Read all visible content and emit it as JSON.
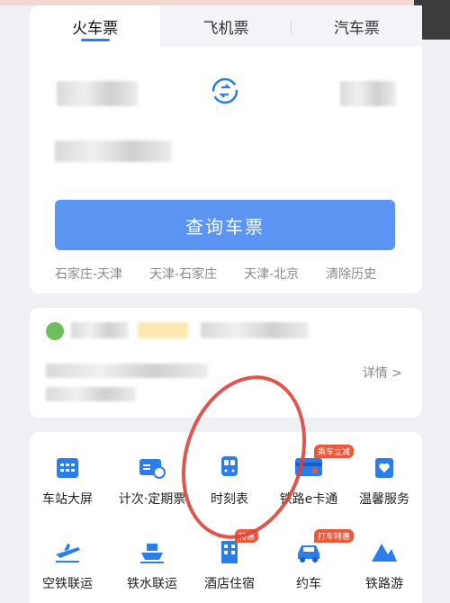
{
  "tabs": [
    {
      "label": "火车票",
      "active": true
    },
    {
      "label": "飞机票",
      "active": false
    },
    {
      "label": "汽车票",
      "active": false
    }
  ],
  "search_button": "查询车票",
  "history": [
    "石家庄-天津",
    "天津-石家庄",
    "天津-北京"
  ],
  "clear_history": "清除历史",
  "order_detail": "详情 >",
  "services": [
    {
      "label": "车站大屏",
      "icon": "station-screen-icon",
      "tag": ""
    },
    {
      "label": "计次·定期票",
      "icon": "ticket-clock-icon",
      "tag": ""
    },
    {
      "label": "时刻表",
      "icon": "train-icon",
      "tag": ""
    },
    {
      "label": "铁路e卡通",
      "icon": "card-icon",
      "tag": "乘车立减"
    },
    {
      "label": "温馨服务",
      "icon": "heart-bag-icon",
      "tag": ""
    },
    {
      "label": "空铁联运",
      "icon": "plane-icon",
      "tag": ""
    },
    {
      "label": "铁水联运",
      "icon": "ship-icon",
      "tag": ""
    },
    {
      "label": "酒店住宿",
      "icon": "hotel-icon",
      "tag": "特惠"
    },
    {
      "label": "约车",
      "icon": "car-icon",
      "tag": "打车特惠"
    },
    {
      "label": "铁路游",
      "icon": "mountain-icon",
      "tag": ""
    }
  ],
  "colors": {
    "accent": "#2b7de9",
    "button": "#5c94f3",
    "circle": "#d9443a"
  }
}
